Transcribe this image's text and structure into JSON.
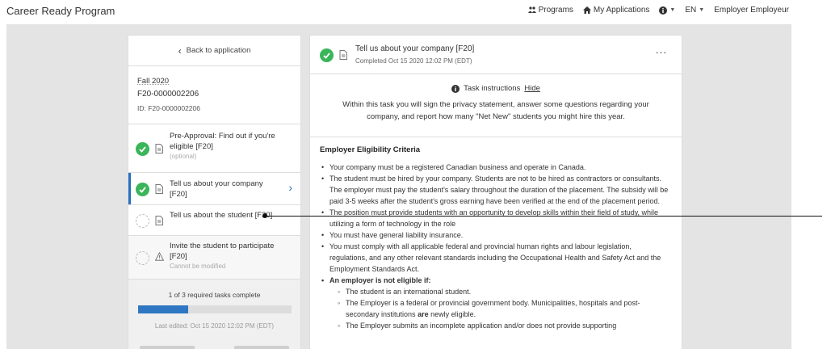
{
  "app": {
    "title": "Career Ready Program"
  },
  "nav": {
    "programs": "Programs",
    "my_applications": "My Applications",
    "language": "EN",
    "user": "Employer Employeur"
  },
  "sidebar": {
    "back_label": "Back to application",
    "term": "Fall 2020",
    "code": "F20-0000002206",
    "id_line": "ID: F20-0000002206",
    "tasks": [
      {
        "title": "Pre-Approval: Find out if you're eligible [F20]",
        "sub": "(optional)",
        "status": "complete"
      },
      {
        "title": "Tell us about your company [F20]",
        "sub": "",
        "status": "complete",
        "active": true
      },
      {
        "title": "Tell us about the student [F20]",
        "sub": "",
        "status": "incomplete"
      },
      {
        "title": "Invite the student to participate [F20]",
        "sub": "Cannot be modified",
        "status": "locked"
      }
    ],
    "progress_text": "1 of 3 required tasks complete",
    "progress_fraction": 0.33,
    "last_edited": "Last edited: Oct 15 2020 12:02 PM (EDT)"
  },
  "task_panel": {
    "title": "Tell us about your company [F20]",
    "completed": "Completed Oct 15 2020 12:02 PM (EDT)",
    "more": "···",
    "instructions_label": "Task instructions",
    "hide_label": "Hide",
    "instructions_text": "Within this task you will sign the privacy statement, answer some questions regarding your company, and report how many \"Net New\" students you might hire this year.",
    "criteria_heading": "Employer Eligibility Criteria",
    "criteria": [
      "Your company must be a registered Canadian business and operate in Canada.",
      "The student must be hired by your company. Students are not to be hired as contractors or consultants. The employer must pay the student's salary throughout the duration of the placement. The subsidy will be paid 3-5 weeks after the student's gross earning have been verified at the end of the placement period.",
      "The position must provide students with an opportunity to develop skills within their field of study, while utilizing a form of technology in the role",
      "You must have general liability insurance.",
      "You must comply with all applicable federal and provincial human rights and labour legislation, regulations, and any other relevant standards including the Occupational Health and Safety Act and the Employment Standards Act."
    ],
    "not_eligible_heading": "An employer is not eligible if:",
    "not_eligible": [
      "The student is an international student.",
      "The Employer is a federal or provincial government body. Municipalities, hospitals and post-secondary institutions",
      "The Employer submits an incomplete application and/or does not provide supporting"
    ],
    "are_word": "are",
    "newly_eligible": "newly eligible."
  },
  "colors": {
    "accent": "#2a6fbf",
    "success": "#3ab55a",
    "stage": "#e4e4e4"
  }
}
